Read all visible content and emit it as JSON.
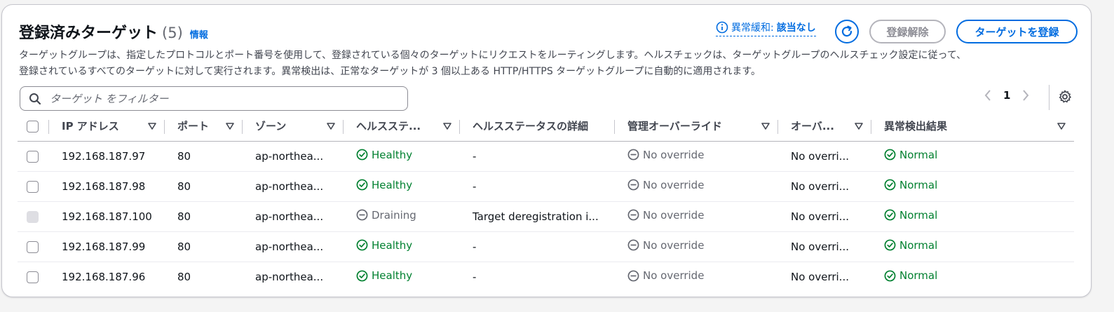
{
  "header": {
    "title": "登録済みターゲット",
    "count": "(5)",
    "info_link": "情報",
    "description_line1": "ターゲットグループは、指定したプロトコルとポート番号を使用して、登録されている個々のターゲットにリクエストをルーティングします。ヘルスチェックは、ターゲットグループのヘルスチェック設定に従って、",
    "description_line2": "登録されているすべてのターゲットに対して実行されます。異常検出は、正常なターゲットが 3 個以上ある HTTP/HTTPS ターゲットグループに自動的に適用されます。"
  },
  "actions": {
    "anomaly_label": "異常緩和:",
    "anomaly_value": "該当なし",
    "deregister_label": "登録解除",
    "register_label": "ターゲットを登録"
  },
  "search": {
    "placeholder": "ターゲット をフィルター",
    "value": ""
  },
  "pagination": {
    "current_page": "1"
  },
  "table": {
    "columns": [
      {
        "label": "IP アドレス"
      },
      {
        "label": "ポート"
      },
      {
        "label": "ゾーン"
      },
      {
        "label": "ヘルスステ..."
      },
      {
        "label": "ヘルスステータスの詳細"
      },
      {
        "label": "管理オーバーライド"
      },
      {
        "label": "オーバ..."
      },
      {
        "label": "異常検出結果"
      }
    ],
    "rows": [
      {
        "ip": "192.168.187.97",
        "port": "80",
        "zone": "ap-northea...",
        "health": "Healthy",
        "detail": "-",
        "admin_override": "No override",
        "override": "No overri...",
        "anomaly": "Normal"
      },
      {
        "ip": "192.168.187.98",
        "port": "80",
        "zone": "ap-northea...",
        "health": "Healthy",
        "detail": "-",
        "admin_override": "No override",
        "override": "No overri...",
        "anomaly": "Normal"
      },
      {
        "ip": "192.168.187.100",
        "port": "80",
        "zone": "ap-northea...",
        "health": "Draining",
        "detail": "Target deregistration i...",
        "admin_override": "No override",
        "override": "No overri...",
        "anomaly": "Normal"
      },
      {
        "ip": "192.168.187.99",
        "port": "80",
        "zone": "ap-northea...",
        "health": "Healthy",
        "detail": "-",
        "admin_override": "No override",
        "override": "No overri...",
        "anomaly": "Normal"
      },
      {
        "ip": "192.168.187.96",
        "port": "80",
        "zone": "ap-northea...",
        "health": "Healthy",
        "detail": "-",
        "admin_override": "No override",
        "override": "No overri...",
        "anomaly": "Normal"
      }
    ]
  },
  "colors": {
    "link": "#006ce0",
    "success": "#00802f",
    "muted": "#656871"
  },
  "icons": {
    "search": "search-icon",
    "refresh": "refresh-icon",
    "info": "info-icon",
    "settings": "gear-icon",
    "healthy": "check-circle-icon",
    "draining": "minus-circle-icon"
  }
}
